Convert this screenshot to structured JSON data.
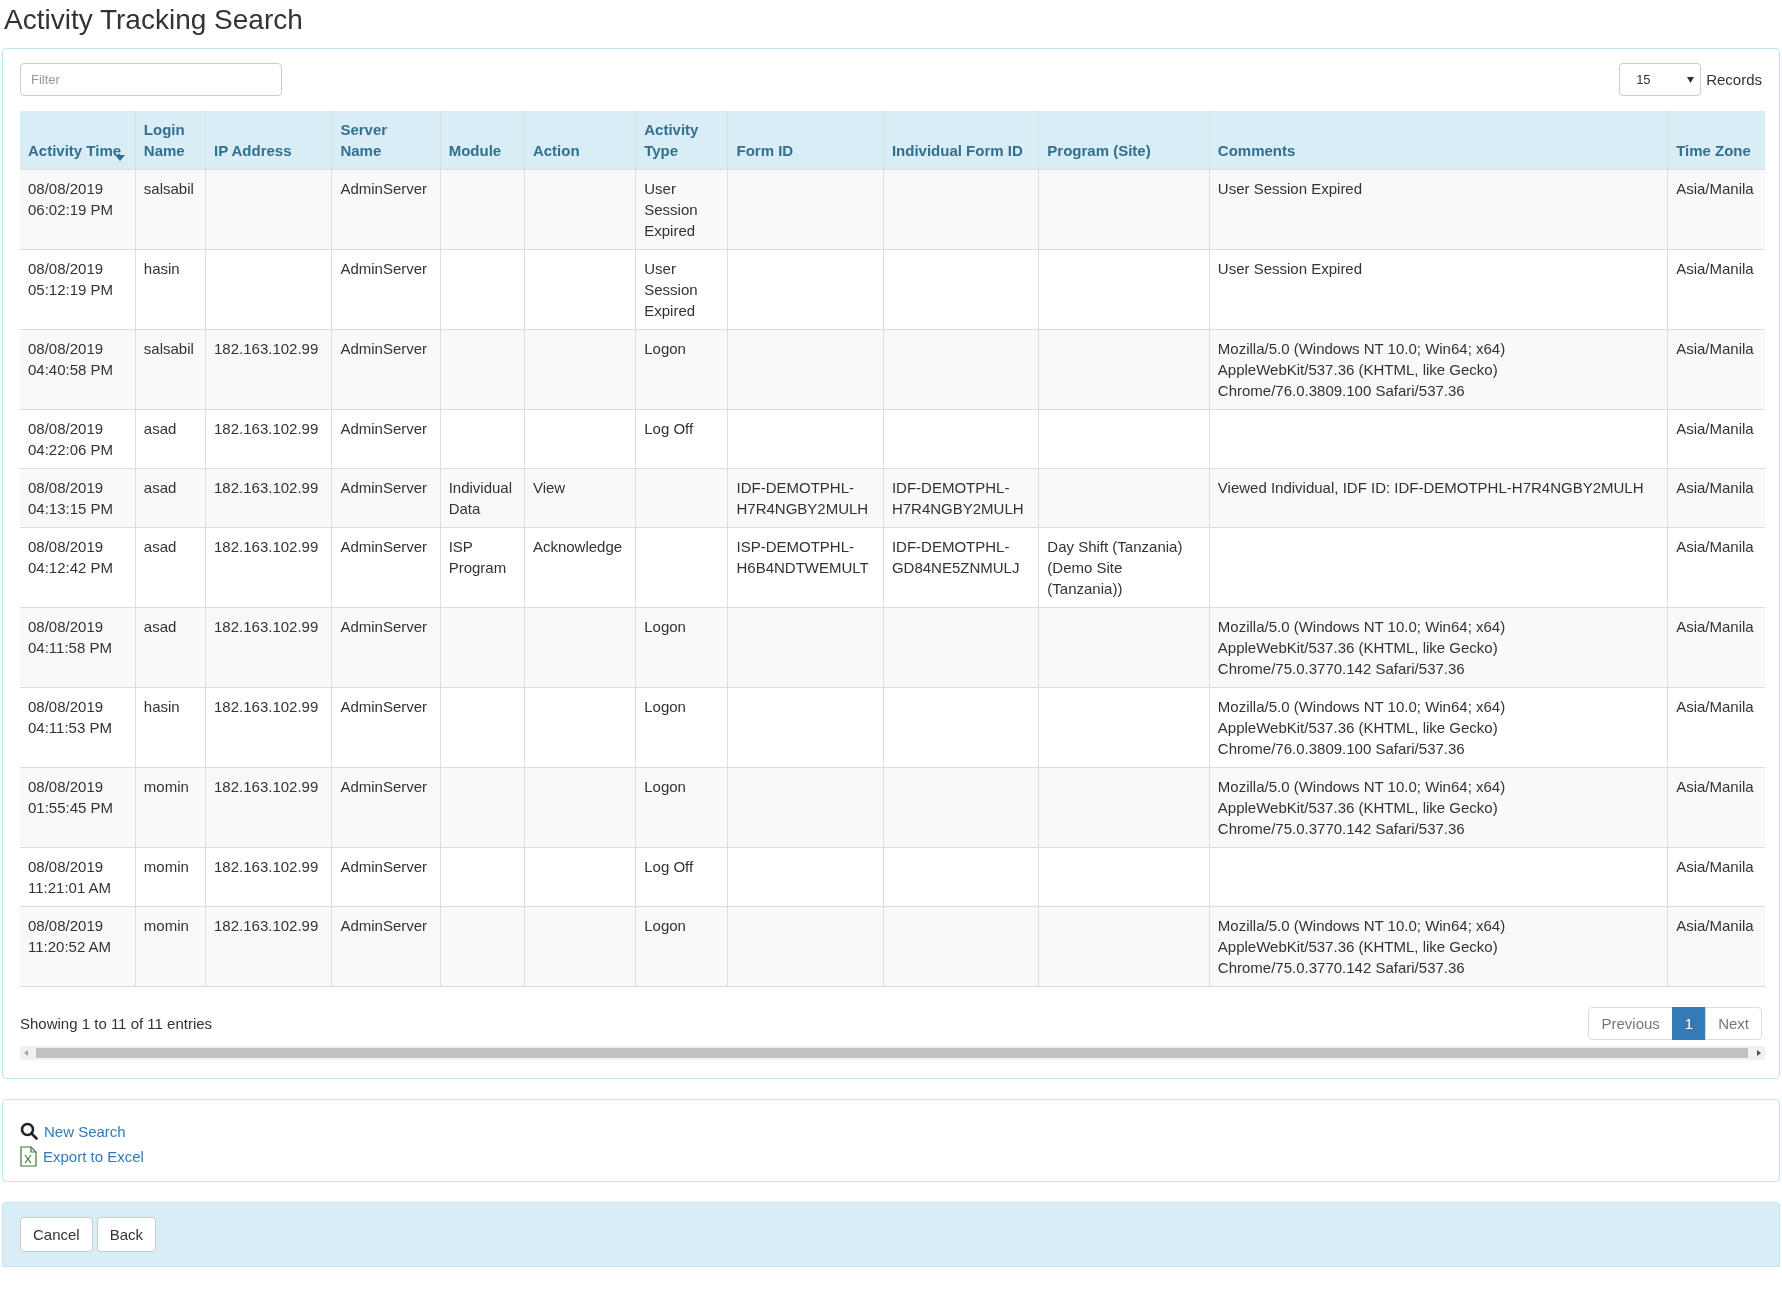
{
  "title": "Activity Tracking Search",
  "filter": {
    "placeholder": "Filter"
  },
  "page_size": {
    "value": "15",
    "label": "Records"
  },
  "table": {
    "columns": [
      {
        "label": "Activity Time",
        "sorted": true
      },
      {
        "label": "Login Name",
        "sorted": false
      },
      {
        "label": "IP Address",
        "sorted": false
      },
      {
        "label": "Server Name",
        "sorted": false
      },
      {
        "label": "Module",
        "sorted": false
      },
      {
        "label": "Action",
        "sorted": false
      },
      {
        "label": "Activity Type",
        "sorted": false
      },
      {
        "label": "Form ID",
        "sorted": false
      },
      {
        "label": "Individual Form ID",
        "sorted": false
      },
      {
        "label": "Program (Site)",
        "sorted": false
      },
      {
        "label": "Comments",
        "sorted": false
      },
      {
        "label": "Time Zone",
        "sorted": false
      }
    ],
    "rows": [
      [
        "08/08/2019 06:02:19 PM",
        "salsabil",
        null,
        "AdminServer",
        null,
        null,
        "User Session Expired",
        null,
        null,
        null,
        "User Session Expired",
        "Asia/Manila"
      ],
      [
        "08/08/2019 05:12:19 PM",
        "hasin",
        null,
        "AdminServer",
        null,
        null,
        "User Session Expired",
        null,
        null,
        null,
        "User Session Expired",
        "Asia/Manila"
      ],
      [
        "08/08/2019 04:40:58 PM",
        "salsabil",
        "182.163.102.99",
        "AdminServer",
        null,
        null,
        "Logon",
        null,
        null,
        null,
        "Mozilla/5.0 (Windows NT 10.0; Win64; x64)\nAppleWebKit/537.36 (KHTML, like Gecko)\nChrome/76.0.3809.100 Safari/537.36",
        "Asia/Manila"
      ],
      [
        "08/08/2019 04:22:06 PM",
        "asad",
        "182.163.102.99",
        "AdminServer",
        null,
        null,
        "Log Off",
        null,
        null,
        null,
        null,
        "Asia/Manila"
      ],
      [
        "08/08/2019 04:13:15 PM",
        "asad",
        "182.163.102.99",
        "AdminServer",
        "Individual Data",
        "View",
        null,
        "IDF-DEMOTPHL-H7R4NGBY2MULH",
        "IDF-DEMOTPHL-H7R4NGBY2MULH",
        null,
        "Viewed Individual, IDF ID: IDF-DEMOTPHL-H7R4NGBY2MULH",
        "Asia/Manila"
      ],
      [
        "08/08/2019 04:12:42 PM",
        "asad",
        "182.163.102.99",
        "AdminServer",
        "ISP Program",
        "Acknowledge",
        null,
        "ISP-DEMOTPHL-H6B4NDTWEMULT",
        "IDF-DEMOTPHL-GD84NE5ZNMULJ",
        "Day Shift (Tanzania) (Demo Site (Tanzania))",
        null,
        "Asia/Manila"
      ],
      [
        "08/08/2019 04:11:58 PM",
        "asad",
        "182.163.102.99",
        "AdminServer",
        null,
        null,
        "Logon",
        null,
        null,
        null,
        "Mozilla/5.0 (Windows NT 10.0; Win64; x64)\nAppleWebKit/537.36 (KHTML, like Gecko)\nChrome/75.0.3770.142 Safari/537.36",
        "Asia/Manila"
      ],
      [
        "08/08/2019 04:11:53 PM",
        "hasin",
        "182.163.102.99",
        "AdminServer",
        null,
        null,
        "Logon",
        null,
        null,
        null,
        "Mozilla/5.0 (Windows NT 10.0; Win64; x64)\nAppleWebKit/537.36 (KHTML, like Gecko)\nChrome/76.0.3809.100 Safari/537.36",
        "Asia/Manila"
      ],
      [
        "08/08/2019 01:55:45 PM",
        "momin",
        "182.163.102.99",
        "AdminServer",
        null,
        null,
        "Logon",
        null,
        null,
        null,
        "Mozilla/5.0 (Windows NT 10.0; Win64; x64)\nAppleWebKit/537.36 (KHTML, like Gecko)\nChrome/75.0.3770.142 Safari/537.36",
        "Asia/Manila"
      ],
      [
        "08/08/2019 11:21:01 AM",
        "momin",
        "182.163.102.99",
        "AdminServer",
        null,
        null,
        "Log Off",
        null,
        null,
        null,
        null,
        "Asia/Manila"
      ],
      [
        "08/08/2019 11:20:52 AM",
        "momin",
        "182.163.102.99",
        "AdminServer",
        null,
        null,
        "Logon",
        null,
        null,
        null,
        "Mozilla/5.0 (Windows NT 10.0; Win64; x64)\nAppleWebKit/537.36 (KHTML, like Gecko)\nChrome/75.0.3770.142 Safari/537.36",
        "Asia/Manila"
      ]
    ]
  },
  "info": "Showing 1 to 11 of 11 entries",
  "pagination": [
    {
      "label": "Previous",
      "selected": false,
      "disabled": true
    },
    {
      "label": "1",
      "selected": true,
      "disabled": false
    },
    {
      "label": "Next",
      "selected": false,
      "disabled": true
    }
  ],
  "links": [
    {
      "label": "New Search",
      "kind": "search"
    },
    {
      "label": "Export to Excel",
      "kind": "excel"
    }
  ],
  "buttons": [
    "Cancel",
    "Back"
  ]
}
